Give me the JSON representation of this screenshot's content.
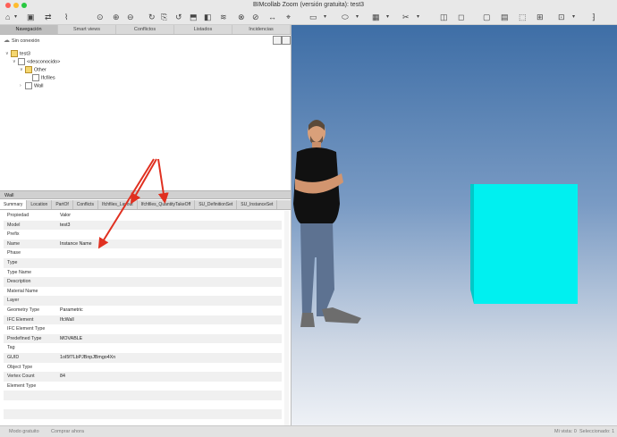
{
  "window": {
    "title": "BIMcollab Zoom (versión gratuita): test3"
  },
  "colors": {
    "close": "#fe5f57",
    "minimize": "#febc2e",
    "maximize": "#28c840",
    "annotation_arrow": "#e03020",
    "wall_color": "#00f0f0"
  },
  "toolbar": {
    "icons": [
      "open-icon",
      "save-icon",
      "selection-icon",
      "measure-icon",
      "show-icon",
      "add-icon",
      "hide-icon",
      "refresh-icon",
      "copy-icon",
      "palette-icon",
      "rotate-icon",
      "section-icon",
      "pan-icon",
      "layer-icon",
      "zoom-icon",
      "box-icon",
      "orbit-icon",
      "walk-icon",
      "clip-icon",
      "color-icon",
      "cube-icon",
      "square-icon",
      "navigate-icon",
      "ruler-icon",
      "frame-icon",
      "nav-cube-icon",
      "more-icon"
    ]
  },
  "tabs": [
    "Navegación",
    "Smart views",
    "Conflictos",
    "Listados",
    "Incidencias"
  ],
  "connection": {
    "label": "Sin conexión"
  },
  "tree": {
    "items": [
      {
        "label": "test3",
        "level": 0
      },
      {
        "label": "<desconocido>",
        "level": 1
      },
      {
        "label": "Other",
        "level": 2
      },
      {
        "label": "Ifcfiles",
        "level": 3
      },
      {
        "label": "Wall",
        "level": 2
      }
    ]
  },
  "properties": {
    "section_title": "Wall",
    "tabs": [
      "Summary",
      "Location",
      "PartOf",
      "Conflicts",
      "Ifchfiles_Layout",
      "Ifchfiles_QuantityTakeOff",
      "SU_DefinitionSet",
      "SU_InstanceSet"
    ],
    "header": {
      "key": "Propiedad",
      "value": "Valor"
    },
    "rows": [
      {
        "key": "Model",
        "value": "test3"
      },
      {
        "key": "Prefix",
        "value": ""
      },
      {
        "key": "Name",
        "value": "Instance Name"
      },
      {
        "key": "Phase",
        "value": ""
      },
      {
        "key": "Type",
        "value": ""
      },
      {
        "key": "Type Name",
        "value": ""
      },
      {
        "key": "Description",
        "value": ""
      },
      {
        "key": "Material Name",
        "value": ""
      },
      {
        "key": "Layer",
        "value": ""
      },
      {
        "key": "Geometry Type",
        "value": "Parametric"
      },
      {
        "key": "IFC Element",
        "value": "IfcWall"
      },
      {
        "key": "IFC Element Type",
        "value": ""
      },
      {
        "key": "Predefined Type",
        "value": "MOVABLE"
      },
      {
        "key": "Tag",
        "value": ""
      },
      {
        "key": "GUID",
        "value": "1oI5f7LbPJBnpJBmgo4Xn"
      },
      {
        "key": "Object Type",
        "value": ""
      },
      {
        "key": "Vertex Count",
        "value": "84"
      },
      {
        "key": "Element Type",
        "value": ""
      },
      {
        "key": "",
        "value": ""
      },
      {
        "key": "",
        "value": ""
      },
      {
        "key": "",
        "value": ""
      }
    ]
  },
  "status": {
    "mode": "Modo gratuito",
    "buy": "Comprar ahora",
    "view": "Mi vista: 0",
    "selected": "Seleccionado: 1"
  }
}
